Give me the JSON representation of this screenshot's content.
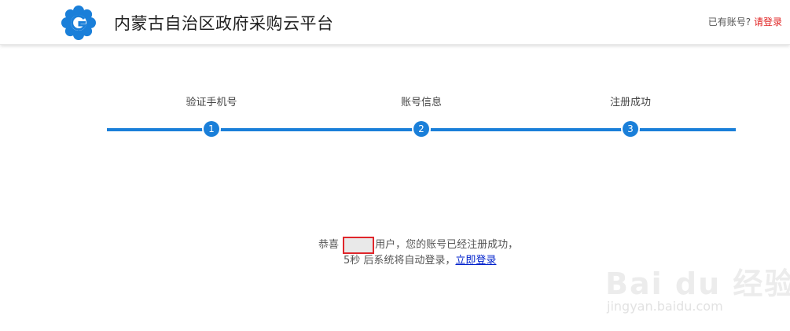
{
  "header": {
    "title": "内蒙古自治区政府采购云平台",
    "login_prompt": "已有账号?",
    "login_link": "请登录",
    "logo_icon": "flower-g-logo-icon",
    "accent_color": "#1a7fd9"
  },
  "steps": [
    {
      "label": "验证手机号",
      "number": "1"
    },
    {
      "label": "账号信息",
      "number": "2"
    },
    {
      "label": "注册成功",
      "number": "3"
    }
  ],
  "message": {
    "prefix": "恭喜",
    "suffix": "用户，您的账号已经注册成功，",
    "countdown": "5秒",
    "redirect_text": " 后系统将自动登录，",
    "login_now": "立即登录"
  },
  "watermark": {
    "brand": "Bai du 经验",
    "url": "jingyan.baidu.com"
  }
}
